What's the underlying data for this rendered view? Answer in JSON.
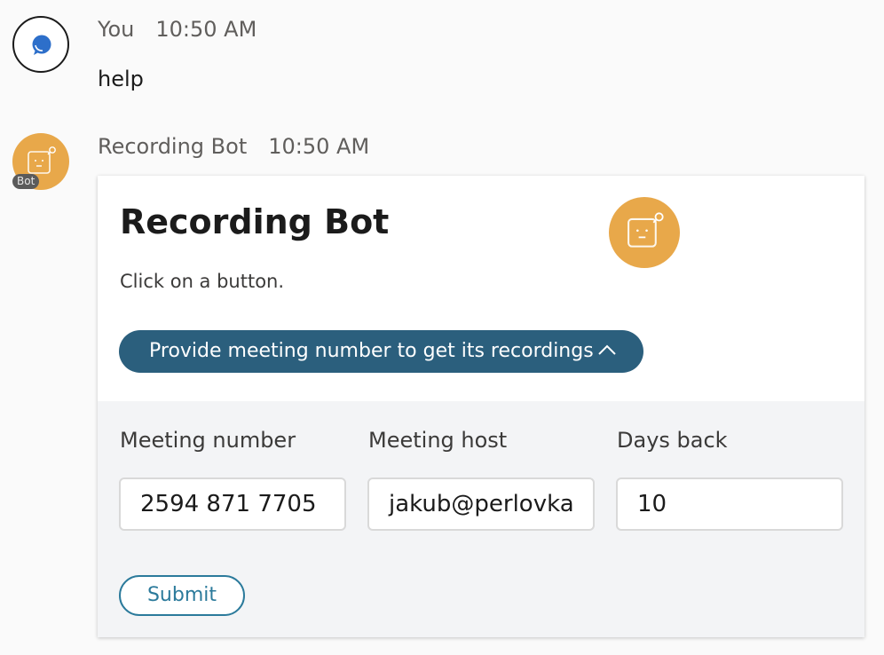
{
  "messages": [
    {
      "sender": "You",
      "time": "10:50 AM",
      "text": "help",
      "avatar_icon": "chat-bubble-icon"
    },
    {
      "sender": "Recording Bot",
      "time": "10:50 AM",
      "avatar_icon": "bot-face-icon",
      "bot_tag": "Bot"
    }
  ],
  "card": {
    "title": "Recording Bot",
    "subtitle": "Click on a button.",
    "logo_icon": "bot-face-icon",
    "action_button": {
      "label": "Provide meeting number to get its recordings",
      "icon": "chevron-up-icon"
    },
    "fields": [
      {
        "label": "Meeting number",
        "value": "2594 871 7705"
      },
      {
        "label": "Meeting host",
        "value": "jakub@perlovka"
      },
      {
        "label": "Days back",
        "value": "10"
      }
    ],
    "submit_label": "Submit"
  },
  "colors": {
    "accent": "#2b5f7d",
    "submit_border": "#2b7a9b",
    "bot_avatar": "#e8a84a",
    "chat_icon": "#2d6fca"
  }
}
